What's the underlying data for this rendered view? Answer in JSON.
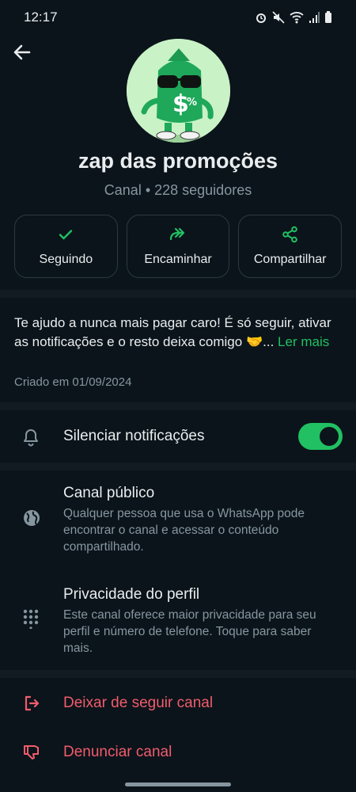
{
  "status": {
    "time": "12:17"
  },
  "channel": {
    "name": "zap das promoções",
    "meta": "Canal • 228 seguidores"
  },
  "actions": [
    {
      "label": "Seguindo",
      "icon": "check-icon"
    },
    {
      "label": "Encaminhar",
      "icon": "forward-icon"
    },
    {
      "label": "Compartilhar",
      "icon": "share-icon"
    }
  ],
  "description": {
    "text": "Te ajudo a nunca mais pagar caro! É só seguir, ativar as notificações e o resto deixa comigo",
    "emoji": "🤝",
    "ellipsis": "...",
    "more": "Ler mais",
    "created": "Criado em 01/09/2024"
  },
  "settings": {
    "mute": {
      "label": "Silenciar notificações",
      "enabled": true,
      "icon": "bell-icon"
    },
    "public": {
      "label": "Canal público",
      "desc": "Qualquer pessoa que usa o WhatsApp pode encontrar o canal e acessar o conteúdo compartilhado.",
      "icon": "globe-icon"
    },
    "privacy": {
      "label": "Privacidade do perfil",
      "desc": "Este canal oferece maior privacidade para seu perfil e número de telefone. Toque para saber mais.",
      "icon": "dots-grid-icon"
    }
  },
  "danger": {
    "unfollow": "Deixar de seguir canal",
    "report": "Denunciar canal"
  },
  "colors": {
    "background": "#0b141a",
    "accent": "#21c063",
    "danger": "#f15c6d",
    "muted_text": "#8696a0"
  }
}
